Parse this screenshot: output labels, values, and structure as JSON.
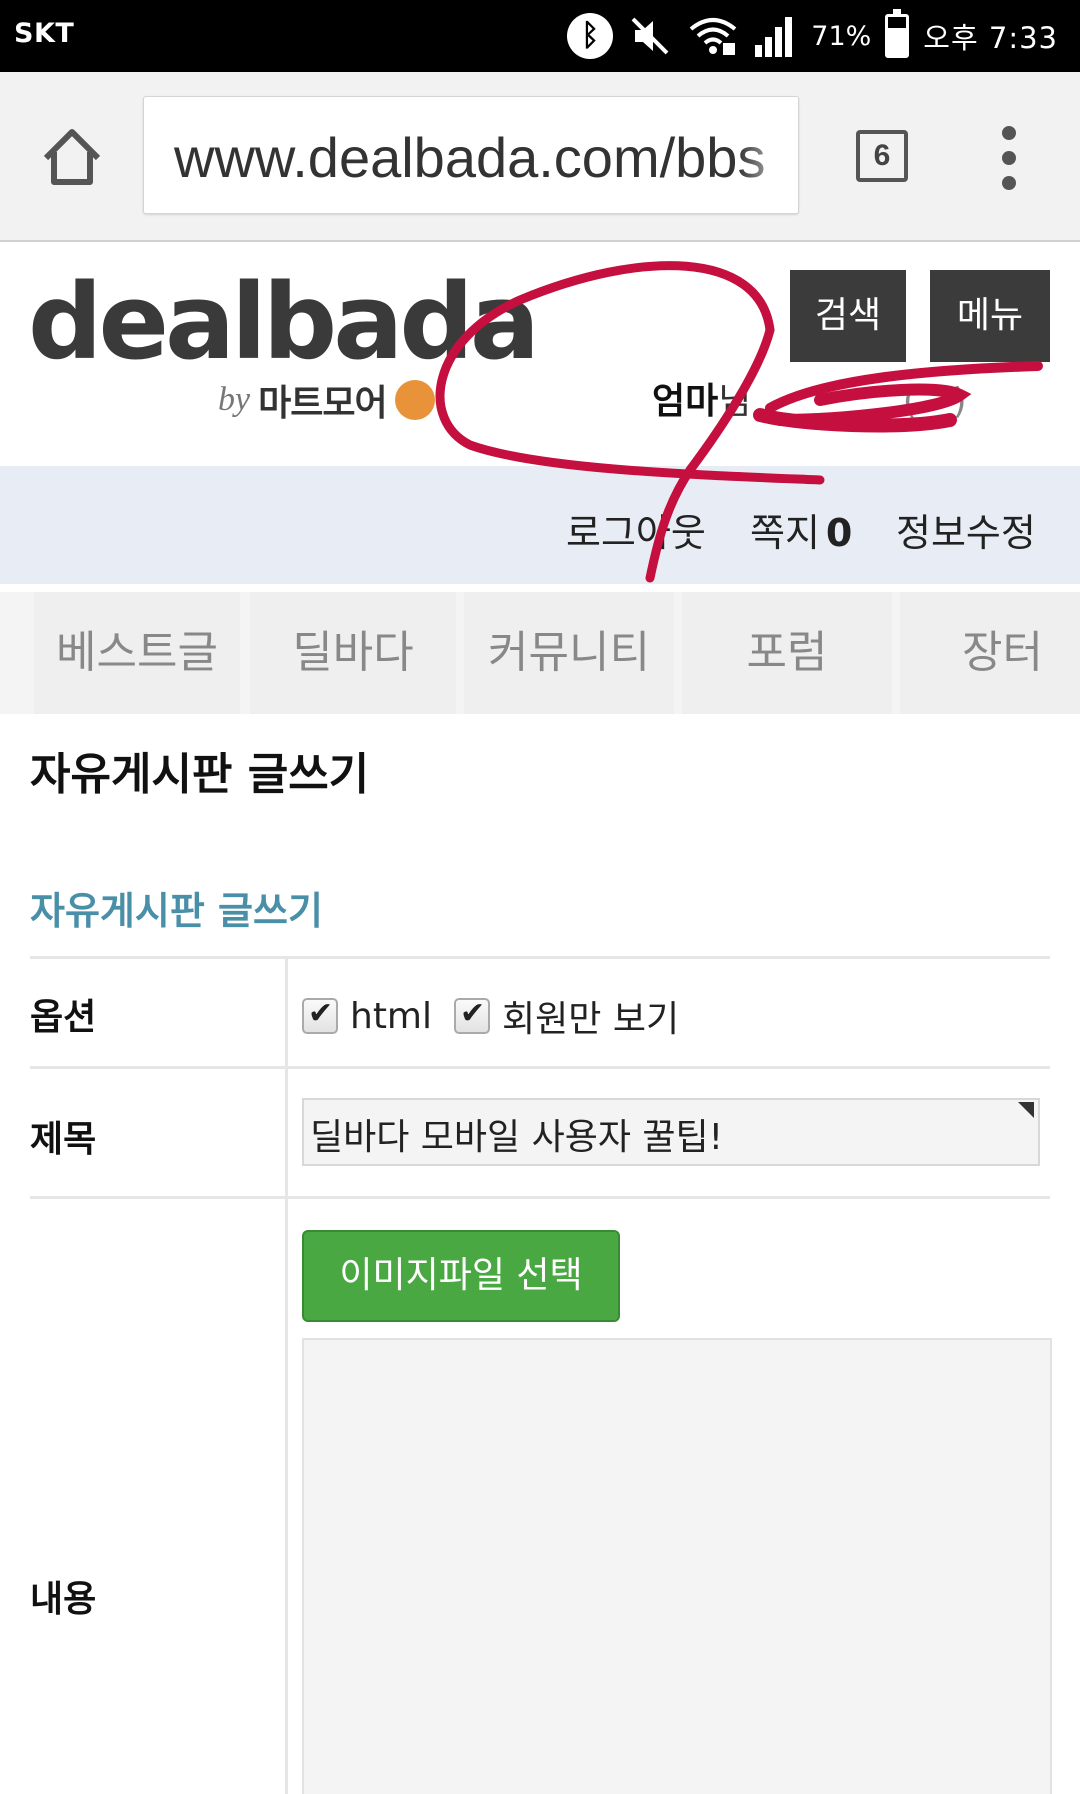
{
  "status_bar": {
    "carrier": "SKT",
    "battery_percent": "71%",
    "time": "오후 7:33"
  },
  "browser": {
    "url": "www.dealbada.com/bbs",
    "tab_count": "6"
  },
  "header": {
    "logo_text": "dealbada",
    "logo_by": "by",
    "logo_sub": "마트모어",
    "search_label": "검색",
    "menu_label": "메뉴",
    "user_name": "엄마",
    "user_suffix": "님",
    "user_paren": "( - )"
  },
  "subnav": {
    "logout": "로그아웃",
    "messages_label": "쪽지",
    "messages_count": "0",
    "edit_info": "정보수정"
  },
  "categories": [
    {
      "label": "베스트글"
    },
    {
      "label": "딜바다"
    },
    {
      "label": "커뮤니티"
    },
    {
      "label": "포럼"
    },
    {
      "label": "장터"
    }
  ],
  "page": {
    "title": "자유게시판 글쓰기",
    "form_title": "자유게시판 글쓰기"
  },
  "form": {
    "options_label": "옵션",
    "option_html": "html",
    "option_members": "회원만 보기",
    "subject_label": "제목",
    "subject_value": "딜바다 모바일 사용자 꿀팁!",
    "content_label": "내용",
    "image_button": "이미지파일 선택"
  },
  "colors": {
    "accent_teal": "#4a8fa8",
    "button_green": "#4aa843",
    "header_dark": "#3b3b3b",
    "subnav_bg": "#e8edf5",
    "scribble_red": "#c40f3f"
  }
}
